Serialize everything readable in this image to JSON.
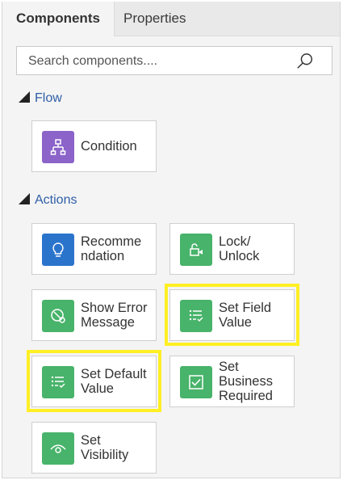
{
  "tabs": {
    "components": "Components",
    "properties": "Properties"
  },
  "search": {
    "placeholder": "Search components...."
  },
  "sections": {
    "flow": "Flow",
    "actions": "Actions"
  },
  "flow_items": [
    {
      "label": "Condition",
      "icon": "condition-branch-icon",
      "color": "#8b63c9"
    }
  ],
  "action_items": [
    {
      "label": "Recommendation",
      "icon": "lightbulb-icon",
      "color": "#2b74cc"
    },
    {
      "label": "Lock/\nUnlock",
      "icon": "lock-unlock-icon",
      "color": "#48b36a"
    },
    {
      "label": "Show Error\nMessage",
      "icon": "error-icon",
      "color": "#48b36a"
    },
    {
      "label": "Set Field\nValue",
      "icon": "list-check-icon",
      "color": "#48b36a",
      "highlighted": true
    },
    {
      "label": "Set Default\nValue",
      "icon": "list-check-icon",
      "color": "#48b36a",
      "highlighted": true
    },
    {
      "label": "Set\nBusiness\nRequired",
      "icon": "checkbox-icon",
      "color": "#48b36a"
    },
    {
      "label": "Set\nVisibility",
      "icon": "eye-icon",
      "color": "#48b36a"
    }
  ],
  "colors": {
    "highlight": "#ffef24",
    "section_text": "#2f5ea7"
  }
}
